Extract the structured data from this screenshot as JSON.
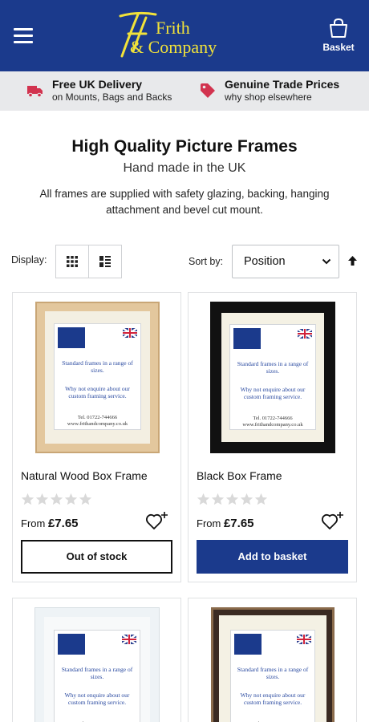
{
  "header": {
    "logo_line1": "Frith",
    "logo_line2": "& Company",
    "basket_label": "Basket"
  },
  "usp": [
    {
      "title": "Free UK Delivery",
      "subtitle": "on Mounts, Bags and Backs",
      "icon": "truck-icon"
    },
    {
      "title": "Genuine Trade Prices",
      "subtitle": "why shop elsewhere",
      "icon": "tag-icon"
    }
  ],
  "page": {
    "title": "High Quality Picture Frames",
    "subtitle": "Hand made in the UK",
    "description": "All frames are supplied with safety glazing, backing, hanging attachment and bevel cut mount."
  },
  "toolbar": {
    "display_label": "Display:",
    "sort_label": "Sort by:",
    "sort_value": "Position"
  },
  "insert": {
    "text1": "Standard frames in a range of sizes.",
    "text2": "Why not enquire about our custom framing service.",
    "text3": "Tel. 01722-744666 www.frithandcompany.co.uk"
  },
  "products": [
    {
      "name": "Natural Wood Box Frame",
      "price_prefix": "From",
      "price": "£7.65",
      "rating": 0,
      "button": "Out of stock",
      "frame_color": "#e3c79d"
    },
    {
      "name": "Black Box Frame",
      "price_prefix": "From",
      "price": "£7.65",
      "rating": 0,
      "button": "Add to basket",
      "frame_color": "#111111"
    },
    {
      "frame_color": "#eef3f6"
    },
    {
      "frame_color": "#3a2a22"
    }
  ],
  "colors": {
    "brand_blue": "#1b3a8c",
    "logo_yellow": "#f1e23a",
    "usp_icon": "#d2334f"
  }
}
